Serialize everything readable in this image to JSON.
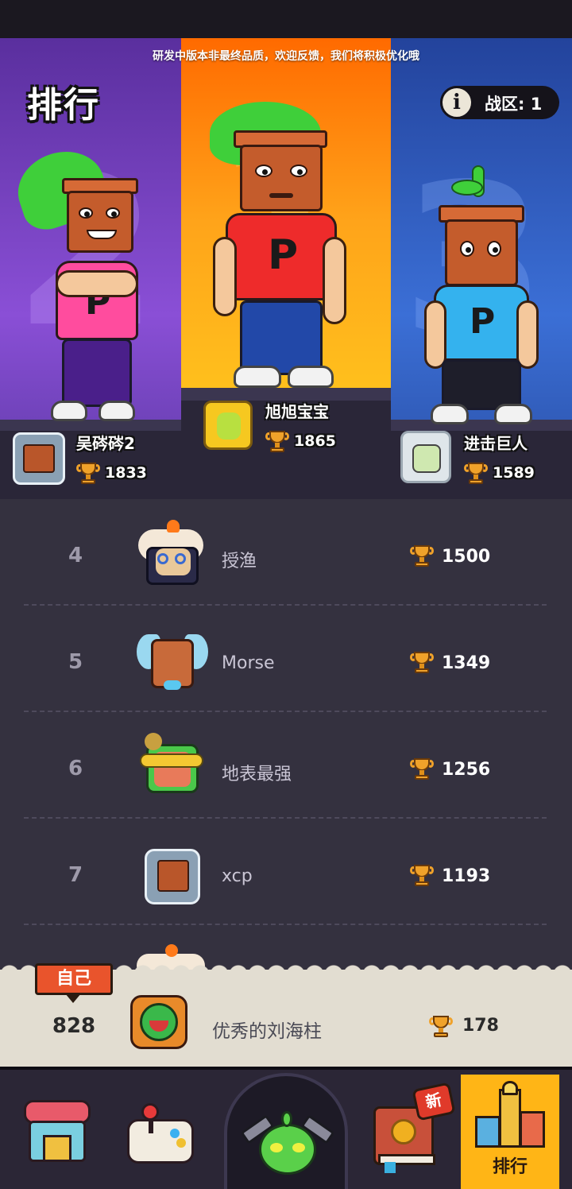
{
  "notice": "研发中版本非最终品质，欢迎反馈，我们将积极优化哦",
  "title": "排行",
  "zone": {
    "info_icon": "i",
    "label": "战区: 1"
  },
  "podium": [
    {
      "place": 2,
      "big_number": "2",
      "name": "吴硶硶2",
      "score": "1833"
    },
    {
      "place": 1,
      "big_number": "1",
      "name": "旭旭宝宝",
      "score": "1865"
    },
    {
      "place": 3,
      "big_number": "3",
      "name": "进击巨人",
      "score": "1589"
    }
  ],
  "rows": [
    {
      "rank": "4",
      "name": "授渔",
      "score": "1500"
    },
    {
      "rank": "5",
      "name": "Morse",
      "score": "1349"
    },
    {
      "rank": "6",
      "name": "地表最强",
      "score": "1256"
    },
    {
      "rank": "7",
      "name": "xcp",
      "score": "1193"
    }
  ],
  "self": {
    "badge": "自己",
    "rank": "828",
    "name": "优秀的刘海柱",
    "score": "178"
  },
  "nav": {
    "items": [
      {
        "icon": "shop-icon"
      },
      {
        "icon": "gamepad-icon"
      },
      {
        "icon": "battle-sprout-icon"
      },
      {
        "icon": "book-icon",
        "badge": "新"
      },
      {
        "icon": "ranking-icon",
        "label": "排行",
        "active": true
      }
    ]
  },
  "colors": {
    "gold": "#ffb516",
    "list_bg": "#34313f",
    "self_bg": "#e2ddd1",
    "badge_red": "#e9542c"
  }
}
